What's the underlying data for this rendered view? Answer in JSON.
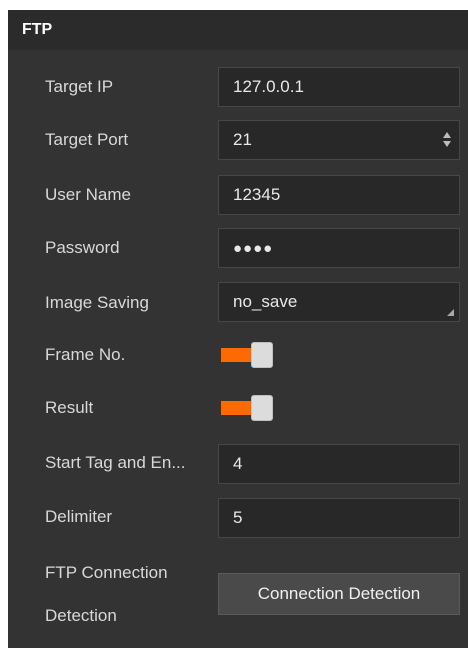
{
  "panel": {
    "title": "FTP"
  },
  "fields": {
    "target_ip": {
      "label": "Target IP",
      "value": "127.0.0.1"
    },
    "target_port": {
      "label": "Target Port",
      "value": "21"
    },
    "user_name": {
      "label": "User Name",
      "value": "12345"
    },
    "password": {
      "label": "Password",
      "value": "●●●●"
    },
    "image_saving": {
      "label": "Image Saving",
      "value": "no_save"
    },
    "frame_no": {
      "label": "Frame No.",
      "enabled": true
    },
    "result": {
      "label": "Result",
      "enabled": true
    },
    "start_tag": {
      "label": "Start Tag and En...",
      "value": "4"
    },
    "delimiter": {
      "label": "Delimiter",
      "value": "5"
    },
    "ftp_connection_detection": {
      "label_line1": "FTP Connection",
      "label_line2": "Detection",
      "button_label": "Connection Detection"
    }
  },
  "colors": {
    "panel_bg": "#333333",
    "header_bg": "#2b2b2b",
    "field_bg": "#282828",
    "toggle_on": "#ff6a00",
    "button_bg": "#4a4a4a"
  },
  "icons": {
    "spin_arrows": "spinbox-arrows-icon",
    "dropdown": "dropdown-corner-icon"
  }
}
